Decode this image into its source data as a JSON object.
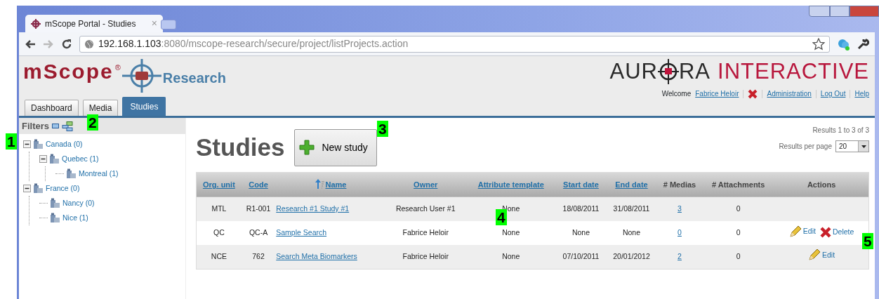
{
  "browser": {
    "tab": {
      "title": "mScope Portal - Studies",
      "close": "×"
    },
    "url": {
      "host": "192.168.1.103",
      "path": ":8080/mscope-research/secure/project/listProjects.action"
    }
  },
  "header": {
    "logo": {
      "name": "mScope",
      "mark": "®",
      "product": "Research"
    },
    "brand": {
      "part_1": "AUR",
      "part_2": "RA",
      "part_3": "INTERACTIVE"
    },
    "welcome": "Welcome",
    "user": "Fabrice Heloir",
    "links": [
      "Administration",
      "Log Out",
      "Help"
    ]
  },
  "tabs": [
    {
      "label": "Dashboard",
      "selected": false
    },
    {
      "label": "Media",
      "selected": false
    },
    {
      "label": "Studies",
      "selected": true
    }
  ],
  "sidebar": {
    "title": "Filters",
    "tree": [
      {
        "label": "Canada (0)",
        "expanded": true,
        "children": [
          {
            "label": "Quebec (1)",
            "expanded": true,
            "children": [
              {
                "label": "Montreal (1)"
              }
            ]
          }
        ]
      },
      {
        "label": "France (0)",
        "expanded": true,
        "children": [
          {
            "label": "Nancy (0)"
          },
          {
            "label": "Nice (1)"
          }
        ]
      }
    ]
  },
  "main": {
    "title": "Studies",
    "new_button": "New study",
    "results": "Results 1 to 3 of 3",
    "per_page_label": "Results per page",
    "per_page": "20"
  },
  "table": {
    "columns": [
      {
        "label": "Org. unit",
        "kind": "text",
        "sortable": true,
        "sorted": false
      },
      {
        "label": "Code",
        "kind": "text",
        "sortable": true,
        "sorted": false
      },
      {
        "label": "Name",
        "kind": "link",
        "sortable": true,
        "sorted": true
      },
      {
        "label": "Owner",
        "kind": "text",
        "sortable": true,
        "sorted": false
      },
      {
        "label": "Attribute template",
        "kind": "text",
        "sortable": true,
        "sorted": false
      },
      {
        "label": "Start date",
        "kind": "text",
        "sortable": true,
        "sorted": false
      },
      {
        "label": "End date",
        "kind": "text",
        "sortable": true,
        "sorted": false
      },
      {
        "label": "# Medias",
        "kind": "link",
        "sortable": false,
        "sorted": false
      },
      {
        "label": "# Attachments",
        "kind": "text",
        "sortable": false,
        "sorted": false
      },
      {
        "label": "Actions",
        "kind": "actions",
        "sortable": false,
        "sorted": false
      }
    ],
    "rows": [
      {
        "cells": [
          "MTL",
          "R1-001",
          "Research #1 Study #1",
          "Research User #1",
          "None",
          "18/08/2011",
          "31/08/2011",
          "3",
          "0"
        ],
        "actions": []
      },
      {
        "cells": [
          "QC",
          "QC-A",
          "Sample Search",
          "Fabrice Heloir",
          "None",
          "None",
          "None",
          "0",
          "0"
        ],
        "actions": [
          {
            "kind": "edit",
            "label": "Edit"
          },
          {
            "kind": "delete",
            "label": "Delete"
          }
        ]
      },
      {
        "cells": [
          "NCE",
          "762",
          "Search Meta Biomarkers",
          "Fabrice Heloir",
          "None",
          "07/10/2011",
          "20/01/2012",
          "2",
          "0"
        ],
        "actions": [
          {
            "kind": "edit",
            "label": "Edit"
          }
        ]
      }
    ]
  },
  "callouts": [
    "1",
    "2",
    "3",
    "4",
    "5"
  ]
}
